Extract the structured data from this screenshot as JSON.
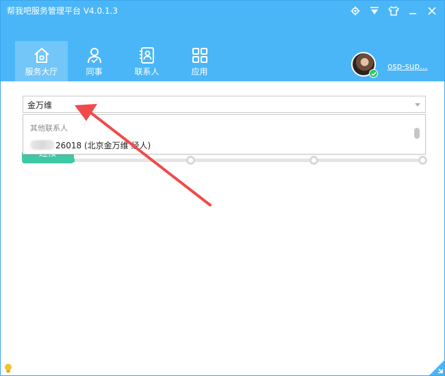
{
  "window": {
    "title": "帮我吧服务管理平台 V4.0.1.3",
    "controls": [
      "gear-icon",
      "dropdown-menu-icon",
      "skin-icon",
      "minimize-icon",
      "close-icon"
    ]
  },
  "nav": {
    "items": [
      {
        "label": "服务大厅",
        "icon": "home-icon",
        "active": true
      },
      {
        "label": "同事",
        "icon": "colleague-icon",
        "active": false
      },
      {
        "label": "联系人",
        "icon": "contacts-icon",
        "active": false
      },
      {
        "label": "应用",
        "icon": "apps-icon",
        "active": false
      }
    ]
  },
  "user": {
    "name": "osp-sup...",
    "status": "online"
  },
  "search": {
    "value": "金万维"
  },
  "dropdown": {
    "group_label": "其他联系人",
    "item_text": "26018 (北京金万维 经人)"
  },
  "connect": {
    "label": "连接"
  },
  "progress": {
    "fill_fraction": 0.13
  },
  "colors": {
    "header": "#4bb6f7",
    "accent_green": "#3ec9a4",
    "annotation_arrow": "#f04a4a"
  }
}
